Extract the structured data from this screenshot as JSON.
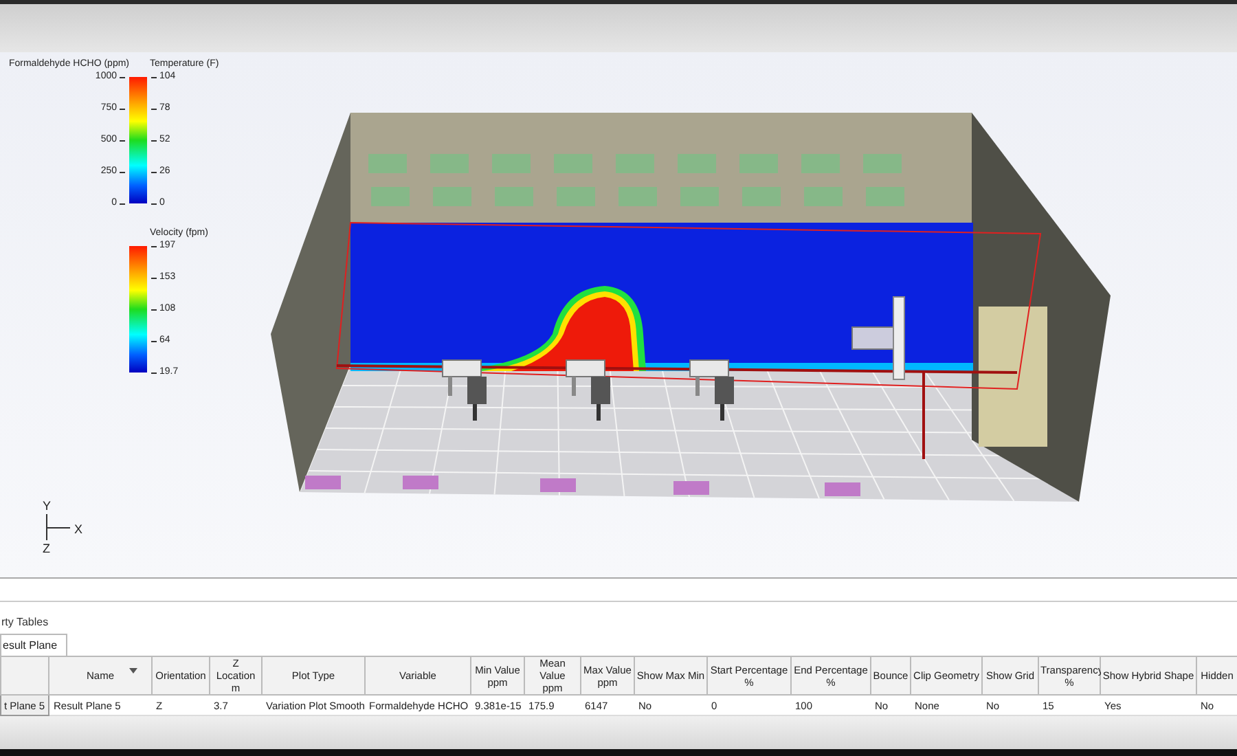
{
  "legends": [
    {
      "left_scale": {
        "title": "Formaldehyde HCHO (ppm)",
        "ticks": [
          "1000",
          "750",
          "500",
          "250",
          "0"
        ]
      },
      "right_scale": {
        "title": "Temperature (F)",
        "ticks": [
          "104",
          "78",
          "52",
          "26",
          "0"
        ]
      }
    },
    {
      "right_scale": {
        "title": "Velocity (fpm)",
        "ticks": [
          "197",
          "153",
          "108",
          "64",
          "19.7"
        ]
      }
    }
  ],
  "axes": {
    "y": "Y",
    "x": "X",
    "z": "Z"
  },
  "panel": {
    "title": "rty Tables",
    "tabs": [
      {
        "label": "esult Plane",
        "selected": true
      }
    ]
  },
  "table": {
    "columns": [
      {},
      {
        "label": "Name",
        "sortable": true
      },
      {
        "label": "Orientation"
      },
      {
        "label": "Z Location",
        "unit": "m"
      },
      {
        "label": "Plot Type"
      },
      {
        "label": "Variable"
      },
      {
        "label": "Min Value",
        "unit": "ppm"
      },
      {
        "label": "Mean Value",
        "unit": "ppm"
      },
      {
        "label": "Max Value",
        "unit": "ppm"
      },
      {
        "label": "Show Max Min"
      },
      {
        "label": "Start Percentage",
        "unit": "%"
      },
      {
        "label": "End Percentage",
        "unit": "%"
      },
      {
        "label": "Bounce"
      },
      {
        "label": "Clip Geometry"
      },
      {
        "label": "Show Grid"
      },
      {
        "label": "Transparency",
        "unit": "%"
      },
      {
        "label": "Show Hybrid Shape"
      },
      {
        "label": "Hidden"
      }
    ],
    "rows": [
      {
        "cells": [
          "t Plane 5",
          "Result Plane 5",
          "Z",
          "3.7",
          "Variation Plot Smooth",
          "Formaldehyde HCHO",
          "9.381e-15",
          "175.9",
          "6147",
          "No",
          "0",
          "100",
          "No",
          "None",
          "No",
          "15",
          "Yes",
          "No"
        ]
      }
    ]
  }
}
